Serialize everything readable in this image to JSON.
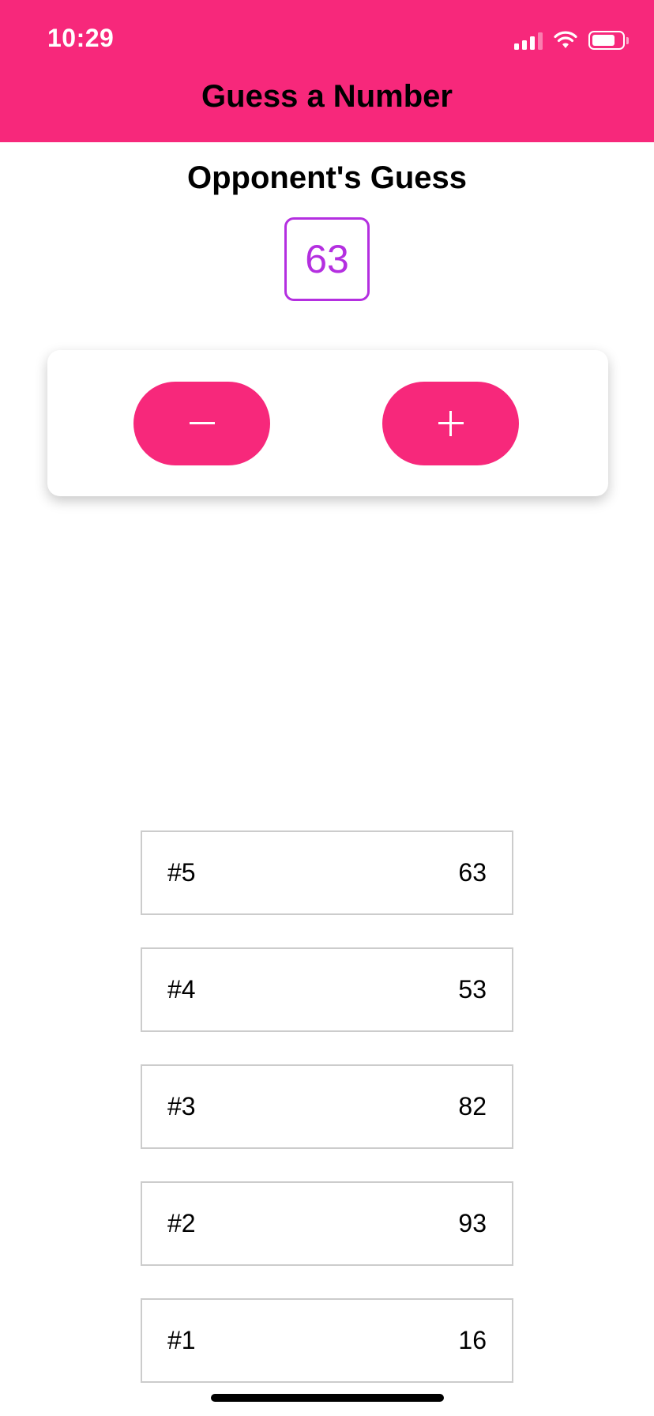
{
  "status_bar": {
    "time": "10:29"
  },
  "header": {
    "title": "Guess a Number",
    "background": "#f7287b"
  },
  "game": {
    "section_title": "Opponent's Guess",
    "current_guess": "63",
    "accent": "#b42fe0"
  },
  "controls": {
    "lower_icon": "minus-icon",
    "higher_icon": "plus-icon"
  },
  "guesses": [
    {
      "round": "#5",
      "value": "63"
    },
    {
      "round": "#4",
      "value": "53"
    },
    {
      "round": "#3",
      "value": "82"
    },
    {
      "round": "#2",
      "value": "93"
    },
    {
      "round": "#1",
      "value": "16"
    }
  ]
}
